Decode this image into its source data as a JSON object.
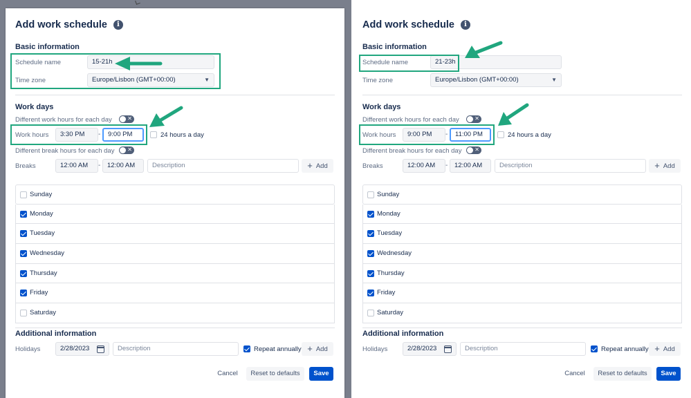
{
  "colors": {
    "primary": "#0052cc",
    "highlight": "#20a67e",
    "checkbox": "#0052cc"
  },
  "dialogs": [
    {
      "title": "Add work schedule",
      "info_icon": "info-icon",
      "basic_info_heading": "Basic information",
      "schedule_name_label": "Schedule name",
      "schedule_name_value": "15-21h",
      "time_zone_label": "Time zone",
      "time_zone_value": "Europe/Lisbon (GMT+00:00)",
      "work_days_heading": "Work days",
      "diff_work_hours_label": "Different work hours for each day",
      "work_hours_label": "Work hours",
      "work_hours_start": "3:30 PM",
      "work_hours_end": "9:00 PM",
      "hours_24_label": "24 hours a day",
      "diff_break_hours_label": "Different break hours for each day",
      "breaks_label": "Breaks",
      "breaks_start": "12:00 AM",
      "breaks_end": "12:00 AM",
      "breaks_description_placeholder": "Description",
      "add_label": "Add",
      "days": [
        {
          "name": "Sunday",
          "checked": false
        },
        {
          "name": "Monday",
          "checked": true
        },
        {
          "name": "Tuesday",
          "checked": true
        },
        {
          "name": "Wednesday",
          "checked": true
        },
        {
          "name": "Thursday",
          "checked": true
        },
        {
          "name": "Friday",
          "checked": true
        },
        {
          "name": "Saturday",
          "checked": false
        }
      ],
      "additional_heading": "Additional information",
      "holidays_label": "Holidays",
      "holiday_date": "2/28/2023",
      "holiday_description_placeholder": "Description",
      "repeat_annually_label": "Repeat annually",
      "cancel_label": "Cancel",
      "reset_label": "Reset to defaults",
      "save_label": "Save"
    },
    {
      "title": "Add work schedule",
      "info_icon": "info-icon",
      "basic_info_heading": "Basic information",
      "schedule_name_label": "Schedule name",
      "schedule_name_value": "21-23h",
      "time_zone_label": "Time zone",
      "time_zone_value": "Europe/Lisbon (GMT+00:00)",
      "work_days_heading": "Work days",
      "diff_work_hours_label": "Different work hours for each day",
      "work_hours_label": "Work hours",
      "work_hours_start": "9:00 PM",
      "work_hours_end": "11:00 PM",
      "hours_24_label": "24 hours a day",
      "diff_break_hours_label": "Different break hours for each day",
      "breaks_label": "Breaks",
      "breaks_start": "12:00 AM",
      "breaks_end": "12:00 AM",
      "breaks_description_placeholder": "Description",
      "add_label": "Add",
      "days": [
        {
          "name": "Sunday",
          "checked": false
        },
        {
          "name": "Monday",
          "checked": true
        },
        {
          "name": "Tuesday",
          "checked": true
        },
        {
          "name": "Wednesday",
          "checked": true
        },
        {
          "name": "Thursday",
          "checked": true
        },
        {
          "name": "Friday",
          "checked": true
        },
        {
          "name": "Saturday",
          "checked": false
        }
      ],
      "additional_heading": "Additional information",
      "holidays_label": "Holidays",
      "holiday_date": "2/28/2023",
      "holiday_description_placeholder": "Description",
      "repeat_annually_label": "Repeat annually",
      "cancel_label": "Cancel",
      "reset_label": "Reset to defaults",
      "save_label": "Save"
    }
  ]
}
